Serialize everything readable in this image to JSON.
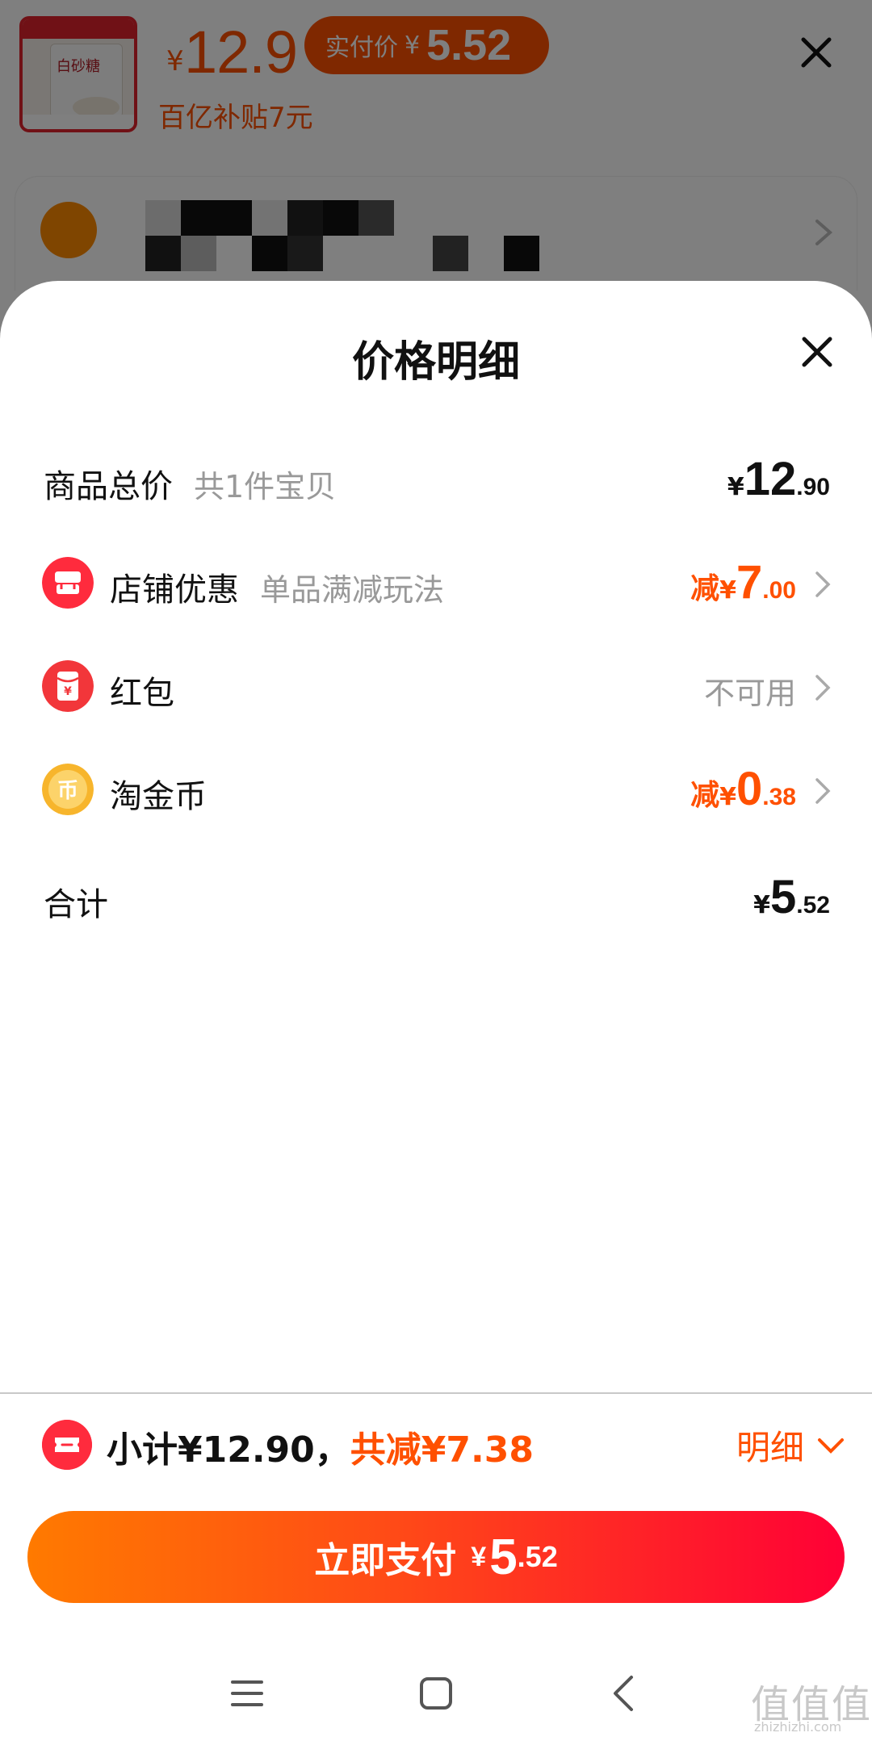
{
  "background": {
    "product_image_label": "白砂糖",
    "price_currency": "¥",
    "price": "12.9",
    "paid_label": "实付价",
    "paid_currency": "¥",
    "paid_amount": "5.52",
    "subsidy_text": "百亿补贴7元"
  },
  "sheet": {
    "title": "价格明细"
  },
  "rows": {
    "goods_total": {
      "label": "商品总价",
      "sub": "共1件宝贝",
      "currency": "¥",
      "int": "12",
      "dec": ".90"
    },
    "store_discount": {
      "label": "店铺优惠",
      "sub": "单品满减玩法",
      "prefix": "减",
      "currency": "¥",
      "int": "7",
      "dec": ".00"
    },
    "red_packet": {
      "label": "红包",
      "icon_glyph": "¥",
      "status": "不可用"
    },
    "coins": {
      "label": "淘金币",
      "icon_glyph": "币",
      "prefix": "减",
      "currency": "¥",
      "int": "0",
      "dec": ".38"
    },
    "total": {
      "label": "合计",
      "currency": "¥",
      "int": "5",
      "dec": ".52"
    }
  },
  "footer": {
    "subtotal_text": "小计¥12.90，",
    "discount_text": "共减¥7.38",
    "detail_label": "明细",
    "pay_label": "立即支付",
    "pay_currency": "¥",
    "pay_int": "5",
    "pay_dec": ".52"
  },
  "watermark": {
    "big": "值值值",
    "small": "zhizhizhi.com"
  },
  "colors": {
    "accent": "#ff5000",
    "pay_gradient_start": "#ff7a00",
    "pay_gradient_end": "#ff0036",
    "store_icon": "#ff2b3d",
    "red_packet_icon": "#f2363a",
    "coin_icon": "#f7b52c"
  },
  "icons": {
    "close": "close-icon",
    "chevron": "chevron-right-icon",
    "store": "store-icon",
    "red_packet": "red-packet-icon",
    "coin": "coin-icon",
    "ticket": "ticket-icon",
    "menu": "menu-icon",
    "home": "home-icon",
    "back": "back-icon"
  }
}
